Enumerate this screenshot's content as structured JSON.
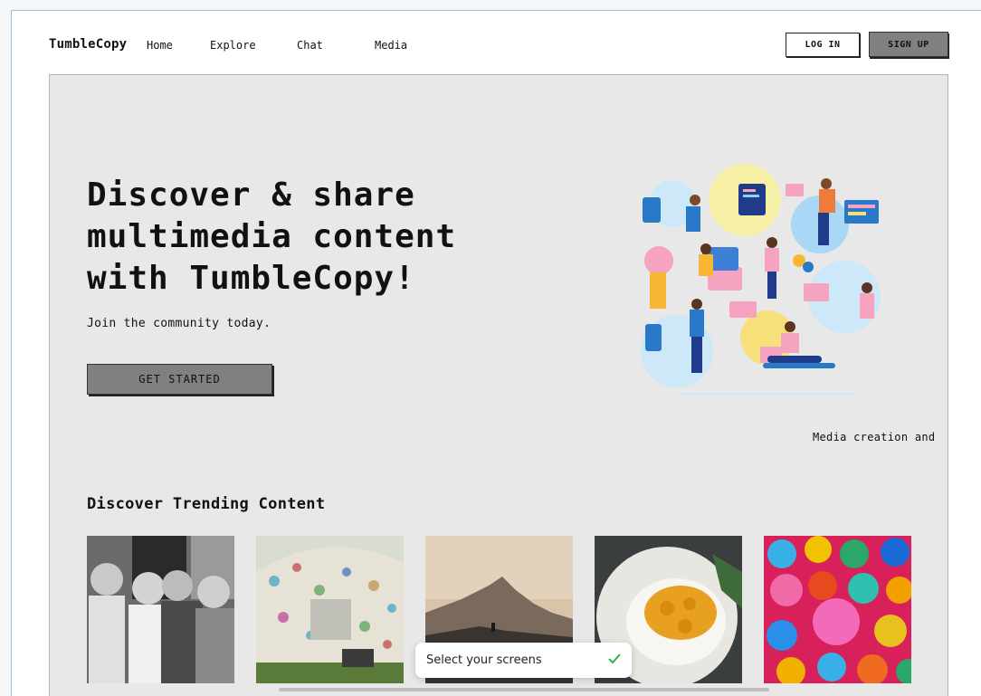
{
  "header": {
    "brand": "TumbleCopy",
    "nav": [
      "Home",
      "Explore",
      "Chat",
      "Media"
    ],
    "login_label": "LOG IN",
    "signup_label": "SIGN UP"
  },
  "hero": {
    "headline": "Discover & share multimedia content with TumbleCopy!",
    "subtitle": "Join the community today.",
    "cta_label": "GET STARTED",
    "illustration_icon": "people-media-collage-illustration",
    "caption": "Media creation and"
  },
  "trending": {
    "title": "Discover Trending Content",
    "cards": [
      {
        "icon": "group-of-smiling-women-photo"
      },
      {
        "icon": "handprint-painted-wall-photo"
      },
      {
        "icon": "mountain-silhouette-sunset-photo"
      },
      {
        "icon": "curry-rice-plate-photo"
      },
      {
        "icon": "colorful-yarn-balls-photo"
      }
    ]
  },
  "toast": {
    "label": "Select your screens",
    "icon": "checkmark-icon",
    "check_color": "#2bb34a"
  },
  "colors": {
    "hero_background": "#e8e8e8",
    "button_gray": "#808080",
    "frame_border": "#8ec3ea"
  }
}
